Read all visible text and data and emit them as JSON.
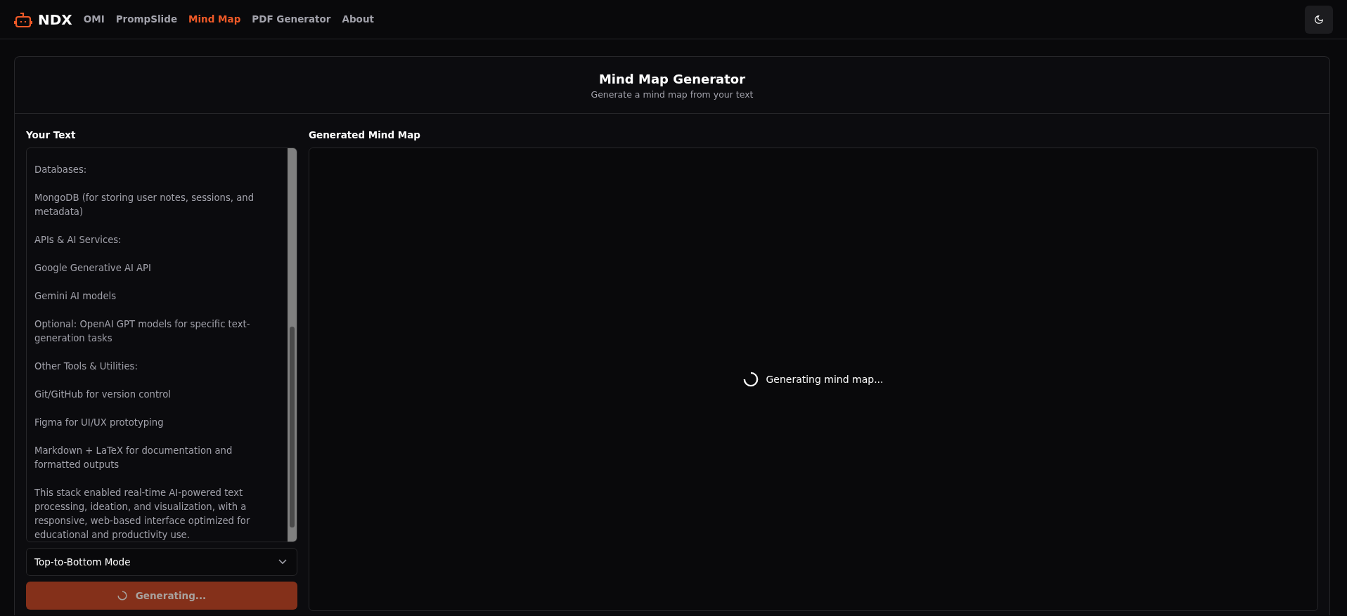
{
  "brand": {
    "name": "NDX"
  },
  "nav": [
    {
      "label": "OMI",
      "selected": false
    },
    {
      "label": "PrompSlide",
      "selected": false
    },
    {
      "label": "Mind Map",
      "selected": true
    },
    {
      "label": "PDF Generator",
      "selected": false
    },
    {
      "label": "About",
      "selected": false
    }
  ],
  "header": {
    "title": "Mind Map Generator",
    "subtitle": "Generate a mind map from your text"
  },
  "input": {
    "label": "Your Text",
    "value": "Databases:\n\nMongoDB (for storing user notes, sessions, and metadata)\n\nAPIs & AI Services:\n\nGoogle Generative AI API\n\nGemini AI models\n\nOptional: OpenAI GPT models for specific text-generation tasks\n\nOther Tools & Utilities:\n\nGit/GitHub for version control\n\nFigma for UI/UX prototyping\n\nMarkdown + LaTeX for documentation and formatted outputs\n\nThis stack enabled real-time AI-powered text processing, ideation, and visualization, with a responsive, web-based interface optimized for educational and productivity use.",
    "mode": "Top-to-Bottom Mode",
    "button": {
      "label": "Generating...",
      "disabled": true
    }
  },
  "output": {
    "label": "Generated Mind Map",
    "status": "Generating mind map..."
  }
}
